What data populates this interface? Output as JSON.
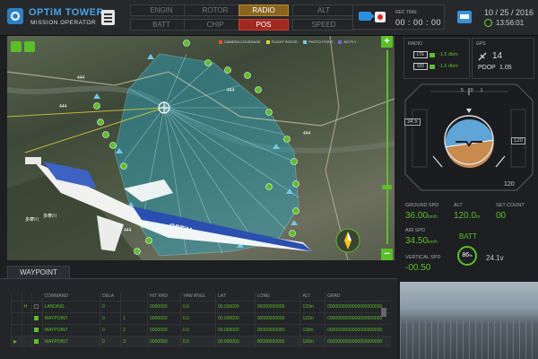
{
  "app": {
    "title": "OPTiM TOWER",
    "subtitle": "MISSION OPERATOR"
  },
  "status_buttons": [
    {
      "label": "ENGIN",
      "state": "normal"
    },
    {
      "label": "ROTOR",
      "state": "normal"
    },
    {
      "label": "RADIO",
      "state": "warning"
    },
    {
      "label": "ALT",
      "state": "normal"
    },
    {
      "label": "BATT",
      "state": "normal"
    },
    {
      "label": "CHIP",
      "state": "normal"
    },
    {
      "label": "POS",
      "state": "error"
    },
    {
      "label": "SPEED",
      "state": "normal"
    }
  ],
  "rec": {
    "label": "REC TIME",
    "time": "00 : 00 : 00"
  },
  "datetime": {
    "date": "10 / 25 / 2016",
    "time": "13:56:01"
  },
  "map": {
    "legend": [
      {
        "label": "CAMERA COVERAGE",
        "color": "#e8562a"
      },
      {
        "label": "FLIGHT ROUTE",
        "color": "#e0d23a"
      },
      {
        "label": "PHOTO POINT",
        "color": "#74c7e8"
      },
      {
        "label": "NO FLY",
        "color": "#6a6cd0"
      }
    ],
    "labels": [
      "444",
      "444",
      "444",
      "444",
      "444",
      "多摩川",
      "多摩川"
    ],
    "banner_text": "OPTiM"
  },
  "radio": {
    "label": "RADIO",
    "rows": [
      {
        "label": "LTE",
        "value": "-1.5 dbm"
      },
      {
        "label": "920",
        "value": "-1.6 dbm"
      }
    ]
  },
  "gps": {
    "label": "GPS",
    "satellites": "14",
    "pdop_label": "PDOP",
    "pdop": "1.05"
  },
  "attitude": {
    "left_tape": "34.5",
    "right_tape": "120",
    "right_bottom": "120",
    "top_ticks": [
      "5",
      "0",
      "1",
      "5"
    ],
    "roll_deg": -8,
    "pitch_deg": 4
  },
  "indicators": [
    {
      "label": "GROUND SPD",
      "value": "36.00",
      "unit": "km/h"
    },
    {
      "label": "ALT",
      "value": "120.0",
      "unit": "m"
    },
    {
      "label": "SET COUNT",
      "value": "00",
      "unit": ""
    },
    {
      "label": "AIR SPD",
      "value": "34.50",
      "unit": "km/h"
    },
    {
      "label": "VERTICAL SPD",
      "value": "-00.50",
      "unit": ""
    }
  ],
  "battery": {
    "label": "BATT",
    "percent": "86",
    "percent_unit": "%",
    "voltage": "24.1v"
  },
  "waypoint": {
    "tab_label": "WAYPOINT",
    "columns": [
      "",
      "",
      "",
      "COMMAND",
      "DELA",
      "",
      "HIT RAD",
      "YAW ANGL",
      "LAT",
      "LONG",
      "ALT",
      "GRAD"
    ],
    "rows": [
      {
        "marker": "",
        "h": "H",
        "checked": false,
        "idx": "",
        "command": "LANDING",
        "delay": "0",
        "hit": "0000000",
        "yaw": "0.0",
        "lat": "00.000000",
        "long": "00000000000",
        "alt": "120m",
        "grad": "0000000000000000000000"
      },
      {
        "marker": "",
        "h": "",
        "checked": true,
        "idx": "1",
        "command": "WAYPOINT",
        "delay": "0",
        "hit": "0000000",
        "yaw": "0.0",
        "lat": "00.000000",
        "long": "00000000000",
        "alt": "122m",
        "grad": "0000000000000000000000"
      },
      {
        "marker": "",
        "h": "",
        "checked": true,
        "idx": "2",
        "command": "WAYPOINT",
        "delay": "0",
        "hit": "0000000",
        "yaw": "0.0",
        "lat": "00.000000",
        "long": "00000000000",
        "alt": "118m",
        "grad": "0000000000000000000000"
      },
      {
        "marker": "▶",
        "h": "",
        "checked": true,
        "idx": "3",
        "command": "WAYPOINT",
        "delay": "0",
        "hit": "0000000",
        "yaw": "0.0",
        "lat": "00.000000",
        "long": "00000000000",
        "alt": "120m",
        "grad": "0000000000000000000000"
      }
    ]
  }
}
